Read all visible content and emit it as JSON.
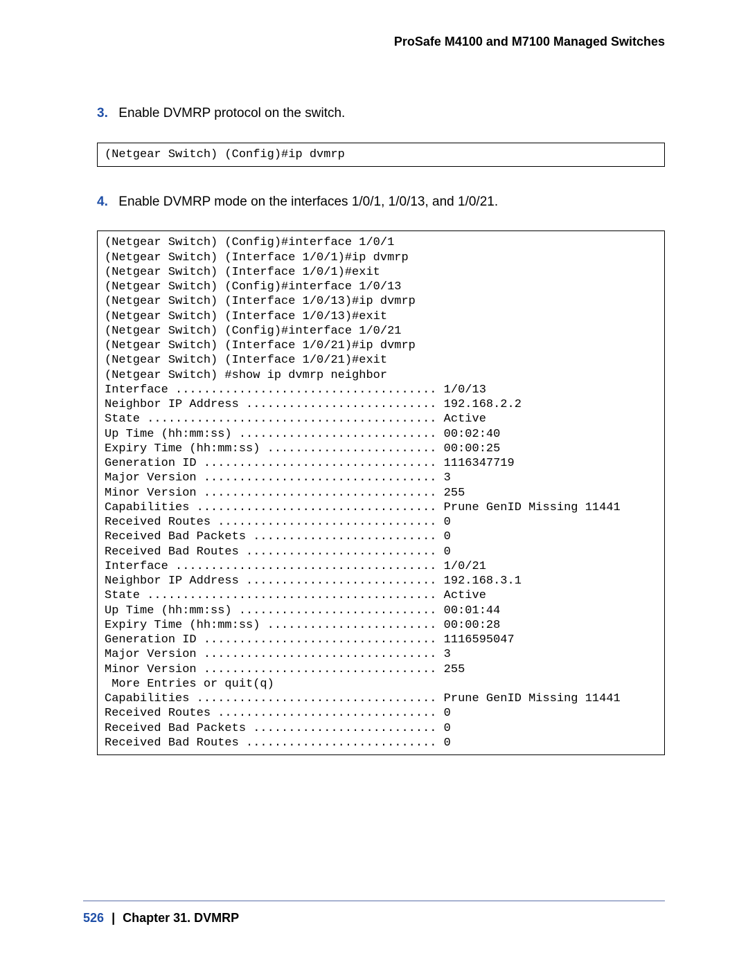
{
  "header": {
    "title": "ProSafe M4100 and M7100 Managed Switches"
  },
  "steps": [
    {
      "num": "3.",
      "text": "Enable DVMRP protocol on the switch."
    },
    {
      "num": "4.",
      "text": "Enable DVMRP mode on the interfaces 1/0/1, 1/0/13, and 1/0/21."
    }
  ],
  "code_blocks": {
    "block1": "(Netgear Switch) (Config)#ip dvmrp",
    "block2": "(Netgear Switch) (Config)#interface 1/0/1\n(Netgear Switch) (Interface 1/0/1)#ip dvmrp\n(Netgear Switch) (Interface 1/0/1)#exit\n(Netgear Switch) (Config)#interface 1/0/13\n(Netgear Switch) (Interface 1/0/13)#ip dvmrp\n(Netgear Switch) (Interface 1/0/13)#exit\n(Netgear Switch) (Config)#interface 1/0/21\n(Netgear Switch) (Interface 1/0/21)#ip dvmrp\n(Netgear Switch) (Interface 1/0/21)#exit\n(Netgear Switch) #show ip dvmrp neighbor\nInterface ..................................... 1/0/13\nNeighbor IP Address ........................... 192.168.2.2\nState ......................................... Active\nUp Time (hh:mm:ss) ............................ 00:02:40\nExpiry Time (hh:mm:ss) ........................ 00:00:25\nGeneration ID ................................. 1116347719\nMajor Version ................................. 3\nMinor Version ................................. 255\nCapabilities .................................. Prune GenID Missing 11441\nReceived Routes ............................... 0\nReceived Bad Packets .......................... 0\nReceived Bad Routes ........................... 0\nInterface ..................................... 1/0/21\nNeighbor IP Address ........................... 192.168.3.1\nState ......................................... Active\nUp Time (hh:mm:ss) ............................ 00:01:44\nExpiry Time (hh:mm:ss) ........................ 00:00:28\nGeneration ID ................................. 1116595047\nMajor Version ................................. 3\nMinor Version ................................. 255\n More Entries or quit(q)\nCapabilities .................................. Prune GenID Missing 11441\nReceived Routes ............................... 0\nReceived Bad Packets .......................... 0\nReceived Bad Routes ........................... 0"
  },
  "footer": {
    "page_number": "526",
    "separator": "|",
    "chapter": "Chapter 31.  DVMRP"
  }
}
